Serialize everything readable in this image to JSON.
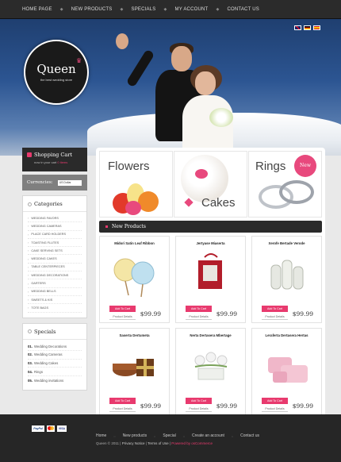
{
  "topnav": {
    "items": [
      "HOME PAGE",
      "NEW PRODUCTS",
      "SPECIALS",
      "MY ACCOUNT",
      "CONTACT US"
    ],
    "separator": "◆"
  },
  "header": {
    "logo_name": "Queen",
    "logo_tagline": "the best wedding store",
    "flags": [
      "en-flag-icon",
      "de-flag-icon",
      "es-flag-icon"
    ]
  },
  "cart": {
    "title": "Shopping Cart",
    "text": "now in your cart",
    "count": "0 items"
  },
  "currency": {
    "label": "Currencies:",
    "selected": "US Dollar"
  },
  "categories": {
    "title": "Categories",
    "items": [
      "WEDDING FAVORS",
      "WEDDING CAMERAS",
      "PLACE CARD HOLDERS",
      "TOASTING FLUTES",
      "CAKE SERVING SETS",
      "WEDDING CAKES",
      "TABLE CENTERPIECES",
      "WEDDING DECORATIONS",
      "GARTERS",
      "WEDDING BELLS",
      "SWEETS & KIS",
      "TOTE BAGS"
    ]
  },
  "specials": {
    "title": "Specials",
    "items": [
      {
        "num": "01.",
        "label": "Wedding Decorations"
      },
      {
        "num": "02.",
        "label": "Wedding Cameras"
      },
      {
        "num": "03.",
        "label": "Wedding Cakes"
      },
      {
        "num": "04.",
        "label": "Rings"
      },
      {
        "num": "05.",
        "label": "Wedding invitations"
      }
    ]
  },
  "promos": [
    {
      "label": "Flowers"
    },
    {
      "label": "Cakes"
    },
    {
      "label": "Rings",
      "badge": "New"
    }
  ],
  "new_products": {
    "title": "New Products",
    "add_label": "Add To Cart",
    "details_label": "Product Details",
    "items": [
      {
        "name": "Midori Satin Leaf Ribbon",
        "price": "$99.99"
      },
      {
        "name": "Jertyase Miaserta",
        "price": "$99.99"
      },
      {
        "name": "Xerofe Bertade Verode",
        "price": "$99.99"
      },
      {
        "name": "Saserta Dertumeta",
        "price": "$99.99"
      },
      {
        "name": "Nerta Dertasera Mbertage",
        "price": "$99.99"
      },
      {
        "name": "Leraferta Dertasera Hertas",
        "price": "$99.99"
      }
    ]
  },
  "footer": {
    "links": [
      "Home",
      "New products",
      "Special",
      "Create an account",
      "Contact us"
    ],
    "separator": "::",
    "copyright": "Queen © 2011",
    "privacy": "Privacy Notice",
    "terms": "Terms of Use",
    "powered": "Powered by osCommerce",
    "payments": [
      "PayPal",
      "mastercard-icon",
      "VISA"
    ]
  },
  "colors": {
    "accent": "#e83a6e",
    "dark": "#2a2a2a"
  }
}
